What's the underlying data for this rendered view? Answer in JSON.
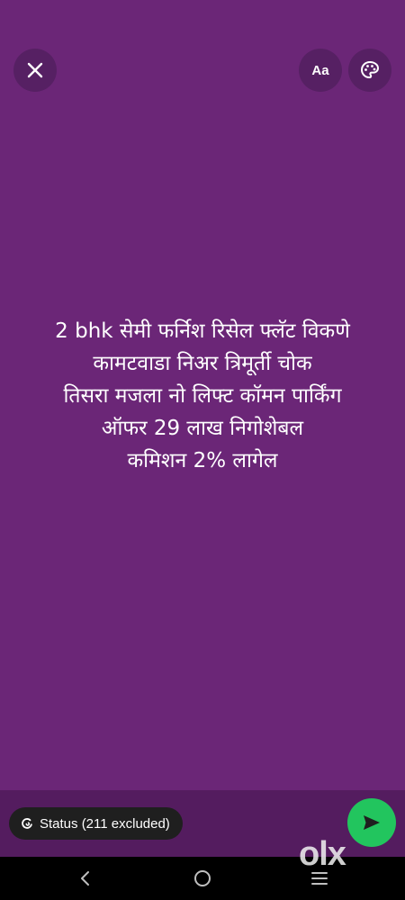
{
  "header": {
    "close_icon": "close-icon",
    "font_button_label": "Aa",
    "palette_icon": "palette-icon"
  },
  "status_text": {
    "lines": [
      "2 bhk सेमी फर्निश रिसेल फ्लॅट विकणे",
      "कामटवाडा निअर त्रिमूर्ती चोक",
      "तिसरा मजला नो लिफ्ट कॉमन पार्किंग",
      "ऑफर 29  लाख निगोशेबल",
      "कमिशन 2% लागेल"
    ],
    "background_color": "#6b2677",
    "text_color": "#ffffff"
  },
  "bottom": {
    "audience_chip_label": "Status (211 excluded)",
    "send_icon": "send-icon",
    "send_color": "#22c55e"
  },
  "watermark": {
    "text": "olx"
  },
  "navbar": {
    "back_icon": "back-icon",
    "home_icon": "home-icon",
    "recents_icon": "recents-icon"
  }
}
